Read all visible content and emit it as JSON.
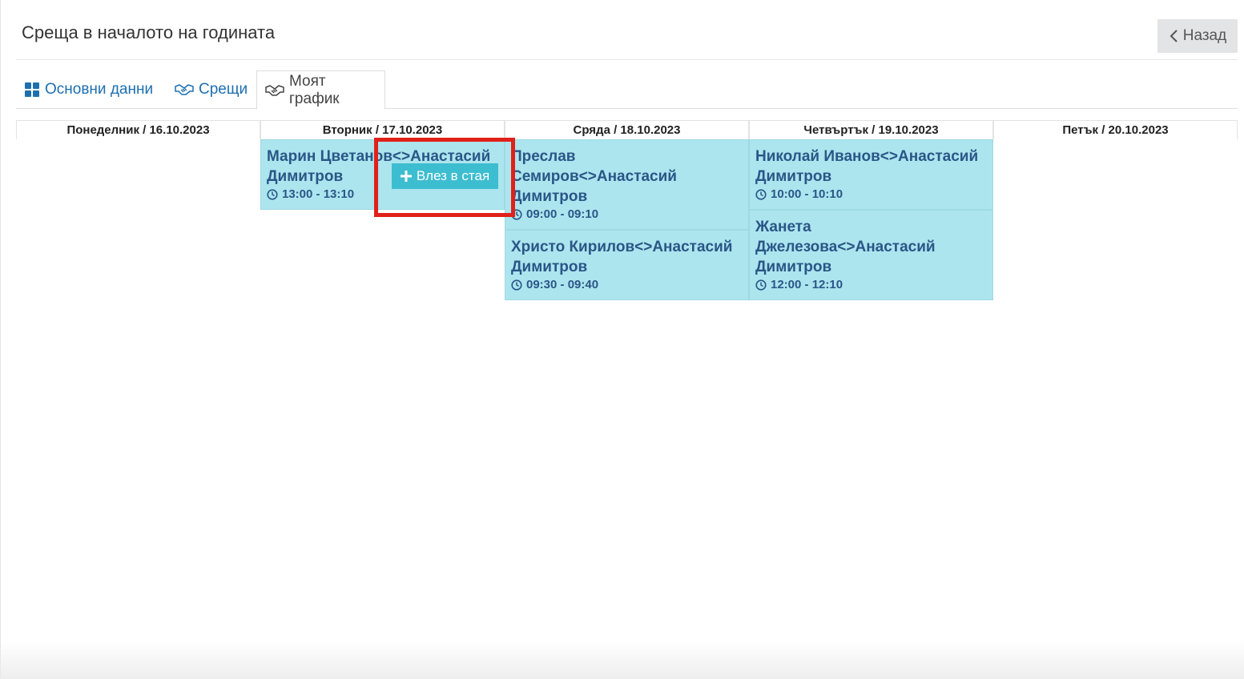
{
  "page": {
    "title": "Среща в началото на годината",
    "back_label": "Назад"
  },
  "tabs": [
    {
      "label": "Основни данни",
      "icon": "grid-icon",
      "active": false
    },
    {
      "label": "Срещи",
      "icon": "handshake-icon",
      "active": false
    },
    {
      "label": "Моят график",
      "icon": "handshake-icon",
      "active": true
    }
  ],
  "days": [
    {
      "label": "Понеделник / 16.10.2023"
    },
    {
      "label": "Вторник / 17.10.2023"
    },
    {
      "label": "Сряда / 18.10.2023"
    },
    {
      "label": "Четвъртък / 19.10.2023"
    },
    {
      "label": "Петък / 20.10.2023"
    }
  ],
  "meetings": [
    {
      "names": "Марин Цветанов<>Анастасий Димитров",
      "time": "13:00 - 13:10"
    },
    {
      "names": "Преслав Семиров<>Анастасий Димитров",
      "time": "09:00 - 09:10"
    },
    {
      "names": "Христо Кирилов<>Анастасий Димитров",
      "time": "09:30 - 09:40"
    },
    {
      "names": "Николай Иванов<>Анастасий Димитров",
      "time": "10:00 - 10:10"
    },
    {
      "names": "Жанета Джелезова<>Анастасий Димитров",
      "time": "12:00 - 12:10"
    }
  ],
  "enter_room_label": "Влез в стая",
  "colors": {
    "meeting_bg": "#ace5ee",
    "meeting_text": "#2a5687",
    "enter_button": "#3dbdd0",
    "highlight": "#e0211a",
    "link": "#1d6fb0"
  }
}
